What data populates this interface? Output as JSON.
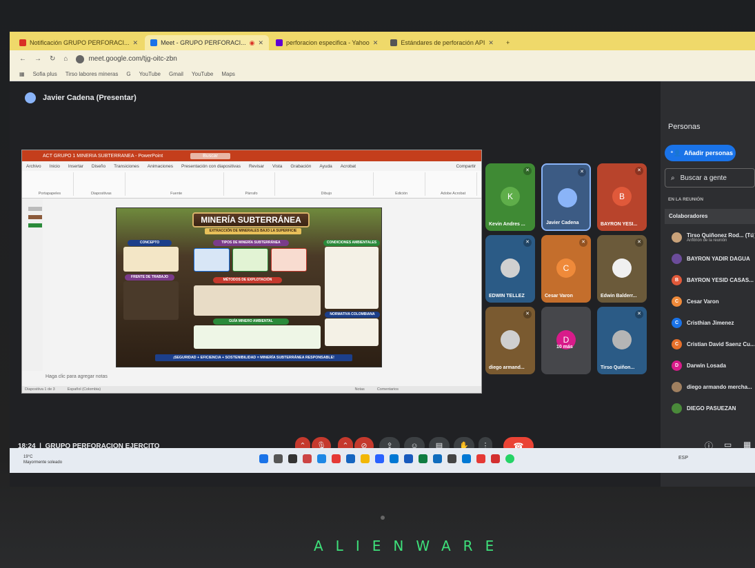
{
  "browser": {
    "tabs": [
      {
        "label": "Notificación GRUPO PERFORACI...",
        "color": "#d93025"
      },
      {
        "label": "Meet - GRUPO PERFORACI...",
        "color": "#1a73e8"
      },
      {
        "label": "perforacion especifica - Yahoo",
        "color": "#6001d2"
      },
      {
        "label": "Estándares de perforación API",
        "color": "#555555"
      }
    ],
    "url": "meet.google.com/tjg-oitc-zbn",
    "bookmarks": [
      "Sofia plus",
      "Tirso labores mineras",
      "G",
      "YouTube",
      "Gmail",
      "YouTube",
      "Maps"
    ]
  },
  "meet": {
    "presenter": "Javier Cadena (Presentar)",
    "time": "18:24",
    "meeting_name": "GRUPO PERFORACION EJERCITO",
    "end_call_color": "#ea4335"
  },
  "ppt": {
    "title": "ACT GRUPO 1 MINERIA SUBTERRANEA - PowerPoint",
    "search": "Buscar",
    "menu": [
      "Archivo",
      "Inicio",
      "Insertar",
      "Diseño",
      "Transiciones",
      "Animaciones",
      "Presentación con diapositivas",
      "Revisar",
      "Vista",
      "Grabación",
      "Ayuda",
      "Acrobat"
    ],
    "share": "Compartir",
    "ribbon_groups": [
      "Portapapeles",
      "Diapositivas",
      "Fuente",
      "Párrafo",
      "Dibujo",
      "Edición",
      "Adobe Acrobat"
    ],
    "notes": "Haga clic para agregar notas",
    "status": [
      "Diapositiva 1 de 3",
      "Español (Colombia)",
      "Notas",
      "Comentarios"
    ],
    "slide": {
      "title": "MINERÍA SUBTERRÁNEA",
      "subtitle": "EXTRACCIÓN DE MINERALES BAJO LA SUPERFICIE",
      "sections": [
        "CONCEPTO",
        "TIPOS DE MINERÍA SUBTERRÁNEA",
        "CONDICIONES AMBIENTALES",
        "FRENTE DE TRABAJO",
        "MÉTODOS DE EXPLOTACIÓN",
        "NORMATIVA COLOMBIANA",
        "GUÍA MINERO AMBIENTAL"
      ],
      "footer": "¡SEGURIDAD + EFICIENCIA + SOSTENIBILIDAD = MINERÍA SUBTERRÁNEA RESPONSABLE!"
    }
  },
  "tiles": [
    {
      "name": "Kevin Andres ...",
      "initial": "K",
      "bg": "#3f8a34",
      "circle": "#5fae4a"
    },
    {
      "name": "Javier Cadena",
      "initial": "",
      "bg": "#3c5b84",
      "circle": "#8ab4f8"
    },
    {
      "name": "BAYRON YESI...",
      "initial": "B",
      "bg": "#b8442c",
      "circle": "#e0593a"
    },
    {
      "name": "EDWIN TELLEZ",
      "initial": "",
      "bg": "#2b5b86",
      "circle": "#d0d0d0"
    },
    {
      "name": "Cesar Varon",
      "initial": "C",
      "bg": "#c46e2c",
      "circle": "#ef8a3a"
    },
    {
      "name": "Edwin Balderr...",
      "initial": "",
      "bg": "#6b5a3a",
      "circle": "#f0f0f0"
    },
    {
      "name": "diego armand...",
      "initial": "",
      "bg": "#7a5a30",
      "circle": "#cfcfcf"
    },
    {
      "name": "10 más",
      "initial": "D",
      "bg": "#46474b",
      "circle": "#d81b8a"
    },
    {
      "name": "Tirso Quiñon...",
      "initial": "",
      "bg": "#2b5b86",
      "circle": "#b5b5b5"
    }
  ],
  "panel": {
    "title": "Personas",
    "add": "Añadir personas",
    "search": "Buscar a gente",
    "in_meeting": "EN LA REUNIÓN",
    "collaborators": "Colaboradores",
    "host_note": "Anfitrión de la reunión",
    "people": [
      {
        "name": "Tirso Quiñonez Rod... (Tú)",
        "initial": "",
        "color": "#c9a27a"
      },
      {
        "name": "BAYRON YADIR DAGUA",
        "initial": "",
        "color": "#6b4c9a"
      },
      {
        "name": "BAYRON YESID CASAS...",
        "initial": "B",
        "color": "#e0593a"
      },
      {
        "name": "Cesar Varon",
        "initial": "C",
        "color": "#ef8a3a"
      },
      {
        "name": "Cristhian Jimenez",
        "initial": "C",
        "color": "#1a73e8"
      },
      {
        "name": "Cristian David Saenz Cu...",
        "initial": "C",
        "color": "#e8702a"
      },
      {
        "name": "Darwin Losada",
        "initial": "D",
        "color": "#d81b8a"
      },
      {
        "name": "diego armando mercha...",
        "initial": "",
        "color": "#a08060"
      },
      {
        "name": "DIEGO PASUEZAN",
        "initial": "",
        "color": "#4a8a3a"
      }
    ]
  },
  "taskbar": {
    "weather_temp": "19°C",
    "weather_desc": "Mayormente soleado",
    "tray": "ESP"
  },
  "brand": "ALIENWARE"
}
